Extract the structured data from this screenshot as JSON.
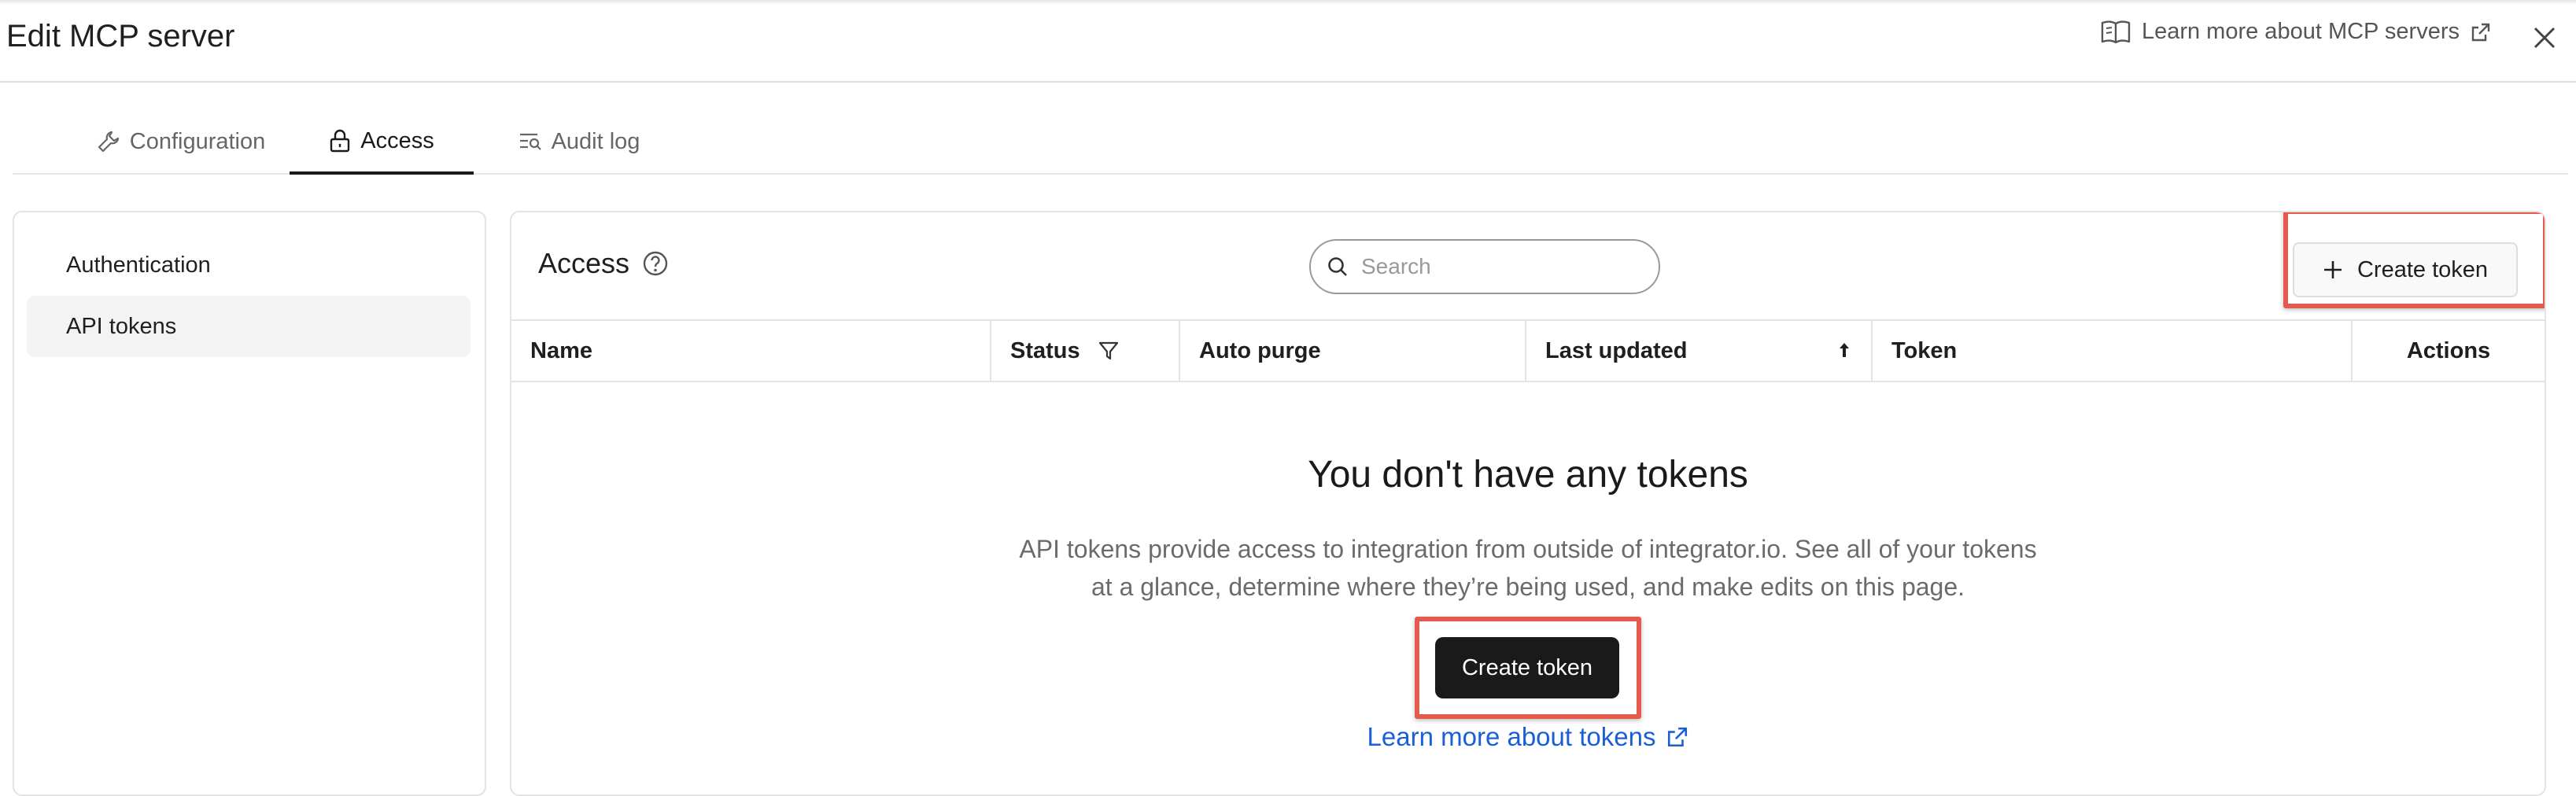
{
  "header": {
    "title": "Edit MCP server",
    "learn_more_label": "Learn more about MCP servers"
  },
  "tabs": [
    {
      "label": "Configuration",
      "active": false,
      "icon": "wrench-icon"
    },
    {
      "label": "Access",
      "active": true,
      "icon": "lock-icon"
    },
    {
      "label": "Audit log",
      "active": false,
      "icon": "audit-list-icon"
    }
  ],
  "sidebar": {
    "items": [
      {
        "label": "Authentication",
        "active": false
      },
      {
        "label": "API tokens",
        "active": true
      }
    ]
  },
  "panel": {
    "title": "Access",
    "search_placeholder": "Search",
    "create_button_label": "Create token"
  },
  "table": {
    "columns": [
      "Name",
      "Status",
      "Auto purge",
      "Last updated",
      "Token",
      "Actions"
    ]
  },
  "empty_state": {
    "title": "You don't have any tokens",
    "description_line1": "API tokens provide access to integration from outside of integrator.io. See all of your tokens",
    "description_line2": "at a glance, determine where they’re being used, and make edits on this page.",
    "button_label": "Create token",
    "learn_more_label": "Learn more about tokens"
  },
  "colors": {
    "highlight": "#e55a4f",
    "link": "#1a5fd6",
    "primary_button": "#1a1a1a"
  }
}
